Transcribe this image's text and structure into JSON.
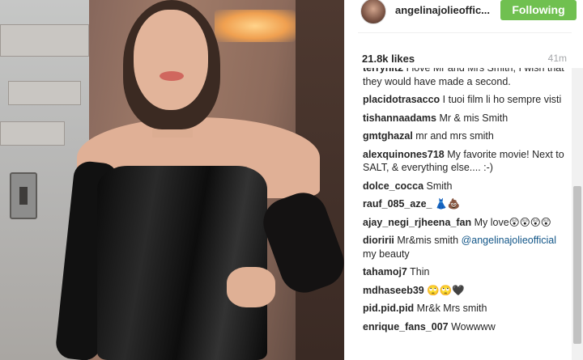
{
  "post": {
    "username": "angelinajolieoffic...",
    "follow_button": "Following",
    "likes": "21.8k likes",
    "time": "41m"
  },
  "comments": [
    {
      "user": "terryhit2",
      "text": "I love Mr and Mrs Smith, I wish that they would have made a second."
    },
    {
      "user": "placidotrasacco",
      "text": "I tuoi film li ho sempre visti"
    },
    {
      "user": "tishannaadams",
      "text": "Mr & mis Smith"
    },
    {
      "user": "gmtghazal",
      "text": "mr and mrs smith"
    },
    {
      "user": "alexquinones718",
      "text": "My favorite movie! Next to SALT, & everything else.... :-)"
    },
    {
      "user": "dolce_cocca",
      "text": "Smith"
    },
    {
      "user": "rauf_085_aze_",
      "text": "👗💩"
    },
    {
      "user": "ajay_negi_rjheena_fan",
      "text": "My love😲😲😲😲"
    },
    {
      "user": "dioririi",
      "text": "Mr&mis smith",
      "mention": "@angelinajolieofficial",
      "after": "my beauty"
    },
    {
      "user": "tahamoj7",
      "text": "Thin"
    },
    {
      "user": "mdhaseeb39",
      "text": "🙄🙄🖤"
    },
    {
      "user": "pid.pid.pid",
      "text": "Mr&k Mrs smith"
    },
    {
      "user": "enrique_fans_007",
      "text": "Wowwww"
    }
  ],
  "icons": {
    "avatar": "profile-avatar",
    "photo": "post-photo"
  },
  "colors": {
    "follow_button": "#70c050",
    "mention": "#125688"
  }
}
